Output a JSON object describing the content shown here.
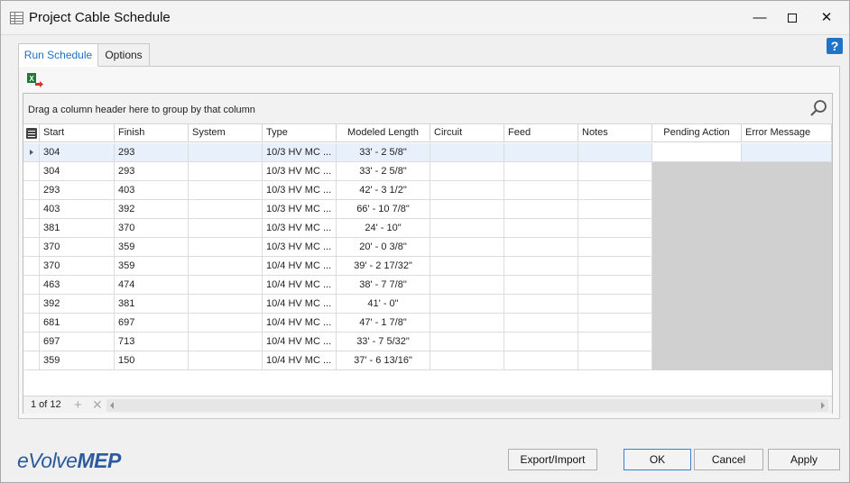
{
  "window": {
    "title": "Project Cable Schedule",
    "minimize_label": "—",
    "close_label": "✕",
    "help_label": "?"
  },
  "tabs": [
    {
      "label": "Run Schedule",
      "active": true
    },
    {
      "label": "Options",
      "active": false
    }
  ],
  "toolbar": {
    "export_excel_icon": "excel-export-icon"
  },
  "grid": {
    "group_hint": "Drag a column header here to group by that column",
    "columns": [
      "Start",
      "Finish",
      "System",
      "Type",
      "Modeled Length",
      "Circuit",
      "Feed",
      "Notes",
      "Pending Action",
      "Error Message"
    ],
    "rows": [
      [
        "304",
        "293",
        "",
        "10/3 HV MC ...",
        "33' - 2 5/8\"",
        "",
        "",
        "",
        "",
        ""
      ],
      [
        "304",
        "293",
        "",
        "10/3 HV MC ...",
        "33' - 2 5/8\"",
        "",
        "",
        "",
        "",
        ""
      ],
      [
        "293",
        "403",
        "",
        "10/3 HV MC ...",
        "42' - 3 1/2\"",
        "",
        "",
        "",
        "",
        ""
      ],
      [
        "403",
        "392",
        "",
        "10/3 HV MC ...",
        "66' - 10 7/8\"",
        "",
        "",
        "",
        "",
        ""
      ],
      [
        "381",
        "370",
        "",
        "10/3 HV MC ...",
        "24' - 10\"",
        "",
        "",
        "",
        "",
        ""
      ],
      [
        "370",
        "359",
        "",
        "10/3 HV MC ...",
        "20' - 0 3/8\"",
        "",
        "",
        "",
        "",
        ""
      ],
      [
        "370",
        "359",
        "",
        "10/4 HV MC ...",
        "39' - 2 17/32\"",
        "",
        "",
        "",
        "",
        ""
      ],
      [
        "463",
        "474",
        "",
        "10/4 HV MC ...",
        "38' - 7 7/8\"",
        "",
        "",
        "",
        "",
        ""
      ],
      [
        "392",
        "381",
        "",
        "10/4 HV MC ...",
        "41' - 0\"",
        "",
        "",
        "",
        "",
        ""
      ],
      [
        "681",
        "697",
        "",
        "10/4 HV MC ...",
        "47' - 1 7/8\"",
        "",
        "",
        "",
        "",
        ""
      ],
      [
        "697",
        "713",
        "",
        "10/4 HV MC ...",
        "33' - 7 5/32\"",
        "",
        "",
        "",
        "",
        ""
      ],
      [
        "359",
        "150",
        "",
        "10/4 HV MC ...",
        "37' - 6 13/16\"",
        "",
        "",
        "",
        "",
        ""
      ]
    ],
    "pager": "1 of 12"
  },
  "footer": {
    "logo_e": "eVolve",
    "logo_mep": "MEP",
    "export_import_label": "Export/Import",
    "ok_label": "OK",
    "cancel_label": "Cancel",
    "apply_label": "Apply"
  },
  "colors": {
    "accent": "#1e6fbf",
    "logo": "#2d5a9c",
    "selected_row": "#e8f0fb"
  }
}
